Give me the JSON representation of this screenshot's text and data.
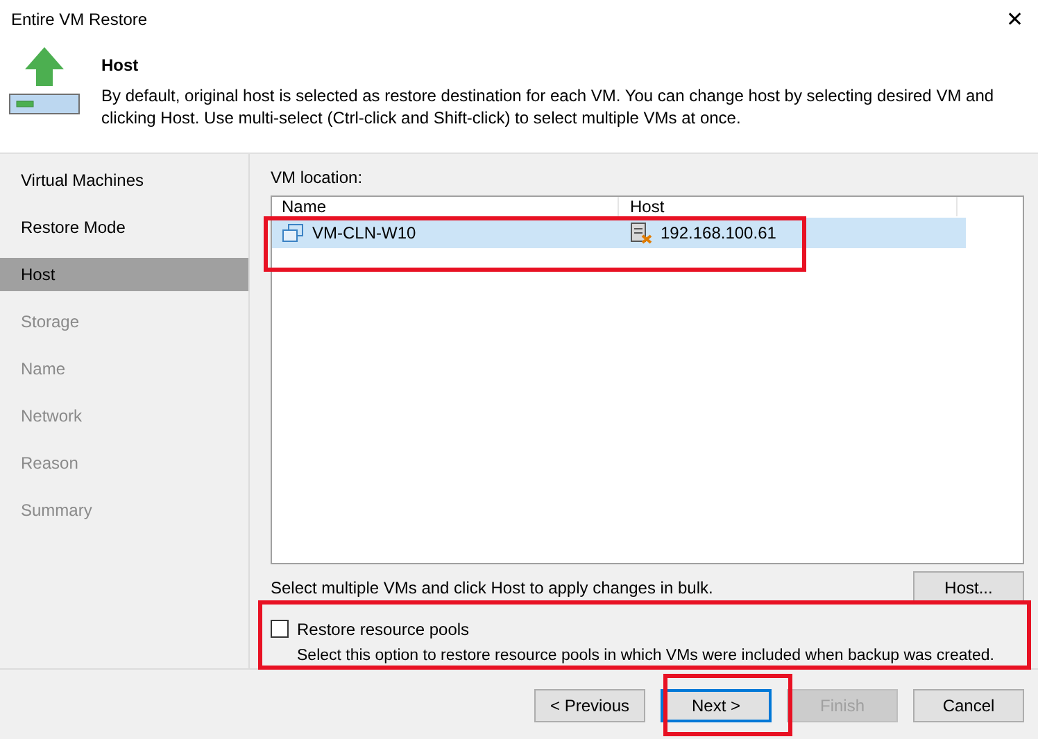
{
  "window": {
    "title": "Entire VM Restore",
    "close": "✕"
  },
  "header": {
    "title": "Host",
    "description": "By default, original host is selected as restore destination for each VM. You can change host by selecting desired VM and clicking Host. Use multi-select (Ctrl-click and Shift-click) to select multiple VMs at once."
  },
  "steps": [
    {
      "label": "Virtual Machines",
      "selected": false,
      "disabled": false
    },
    {
      "label": "Restore Mode",
      "selected": false,
      "disabled": false
    },
    {
      "label": "Host",
      "selected": true,
      "disabled": false
    },
    {
      "label": "Storage",
      "selected": false,
      "disabled": true
    },
    {
      "label": "Name",
      "selected": false,
      "disabled": true
    },
    {
      "label": "Network",
      "selected": false,
      "disabled": true
    },
    {
      "label": "Reason",
      "selected": false,
      "disabled": true
    },
    {
      "label": "Summary",
      "selected": false,
      "disabled": true
    }
  ],
  "vm_location": {
    "label": "VM location:",
    "columns": [
      "Name",
      "Host"
    ],
    "rows": [
      {
        "name": "VM-CLN-W10",
        "host": "192.168.100.61",
        "selected": true
      }
    ]
  },
  "bulk_hint": "Select multiple VMs and click Host to apply changes in bulk.",
  "host_button": "Host...",
  "restore_pools": {
    "label": "Restore resource pools",
    "checked": false,
    "description": "Select this option to restore resource pools in which VMs were included when backup was created."
  },
  "buttons": [
    {
      "label": "< Previous",
      "disabled": false,
      "focused": false
    },
    {
      "label": "Next >",
      "disabled": false,
      "focused": true
    },
    {
      "label": "Finish",
      "disabled": true,
      "focused": false
    },
    {
      "label": "Cancel",
      "disabled": false,
      "focused": false
    }
  ]
}
